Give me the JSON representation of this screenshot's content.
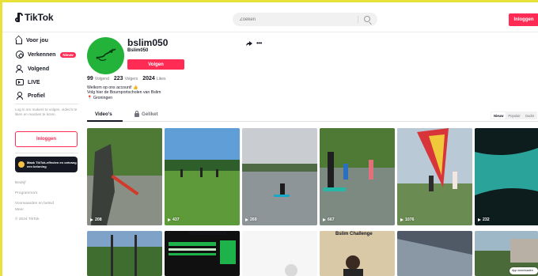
{
  "header": {
    "logo_text": "TikTok",
    "search_placeholder": "Zoeken",
    "login_label": "Inloggen"
  },
  "sidebar": {
    "items": [
      {
        "label": "Voor jou",
        "icon": "home-icon"
      },
      {
        "label": "Verkennen",
        "icon": "compass-icon",
        "badge": "Nieuw"
      },
      {
        "label": "Volgend",
        "icon": "people-icon"
      },
      {
        "label": "LIVE",
        "icon": "live-icon"
      },
      {
        "label": "Profiel",
        "icon": "profile-icon"
      }
    ],
    "login_hint": "Log in om makers te volgen, video's te liken en reacties te lezen.",
    "login_button": "Inloggen",
    "effect_card": "Maak TikTok-effecten en ontvang een beloning",
    "links": [
      "Bedrijf",
      "Programma's",
      "Voorwaarden en beleid",
      "Meer",
      "© 2024 TikTok"
    ]
  },
  "profile": {
    "username": "bslim050",
    "nickname": "Bslim050",
    "follow_label": "Volgen",
    "stats": [
      {
        "value": "99",
        "label": "Volgend"
      },
      {
        "value": "223",
        "label": "Volgers"
      },
      {
        "value": "2024",
        "label": "Likes"
      }
    ],
    "bio": [
      "Welkom op ons account! 👍",
      "Volg hier de Bournportscholen van Bslim",
      "📍 Groningen"
    ]
  },
  "tabs": {
    "videos": "Video's",
    "liked": "Geliket"
  },
  "sort": [
    "Nieuw",
    "Populair",
    "Oudst"
  ],
  "videos": [
    {
      "views": "208"
    },
    {
      "views": "437"
    },
    {
      "views": "269"
    },
    {
      "views": "667"
    },
    {
      "views": "1076"
    },
    {
      "views": "232"
    }
  ],
  "row2_texts": {
    "outdoor": "OUTDOORWEEK",
    "challenge": "Bslim Challenge"
  },
  "app_pill": "App downloaden",
  "colors": {
    "accent": "#fe2c55",
    "avatar_bg": "#23b33a",
    "frame": "#e8e13a"
  }
}
